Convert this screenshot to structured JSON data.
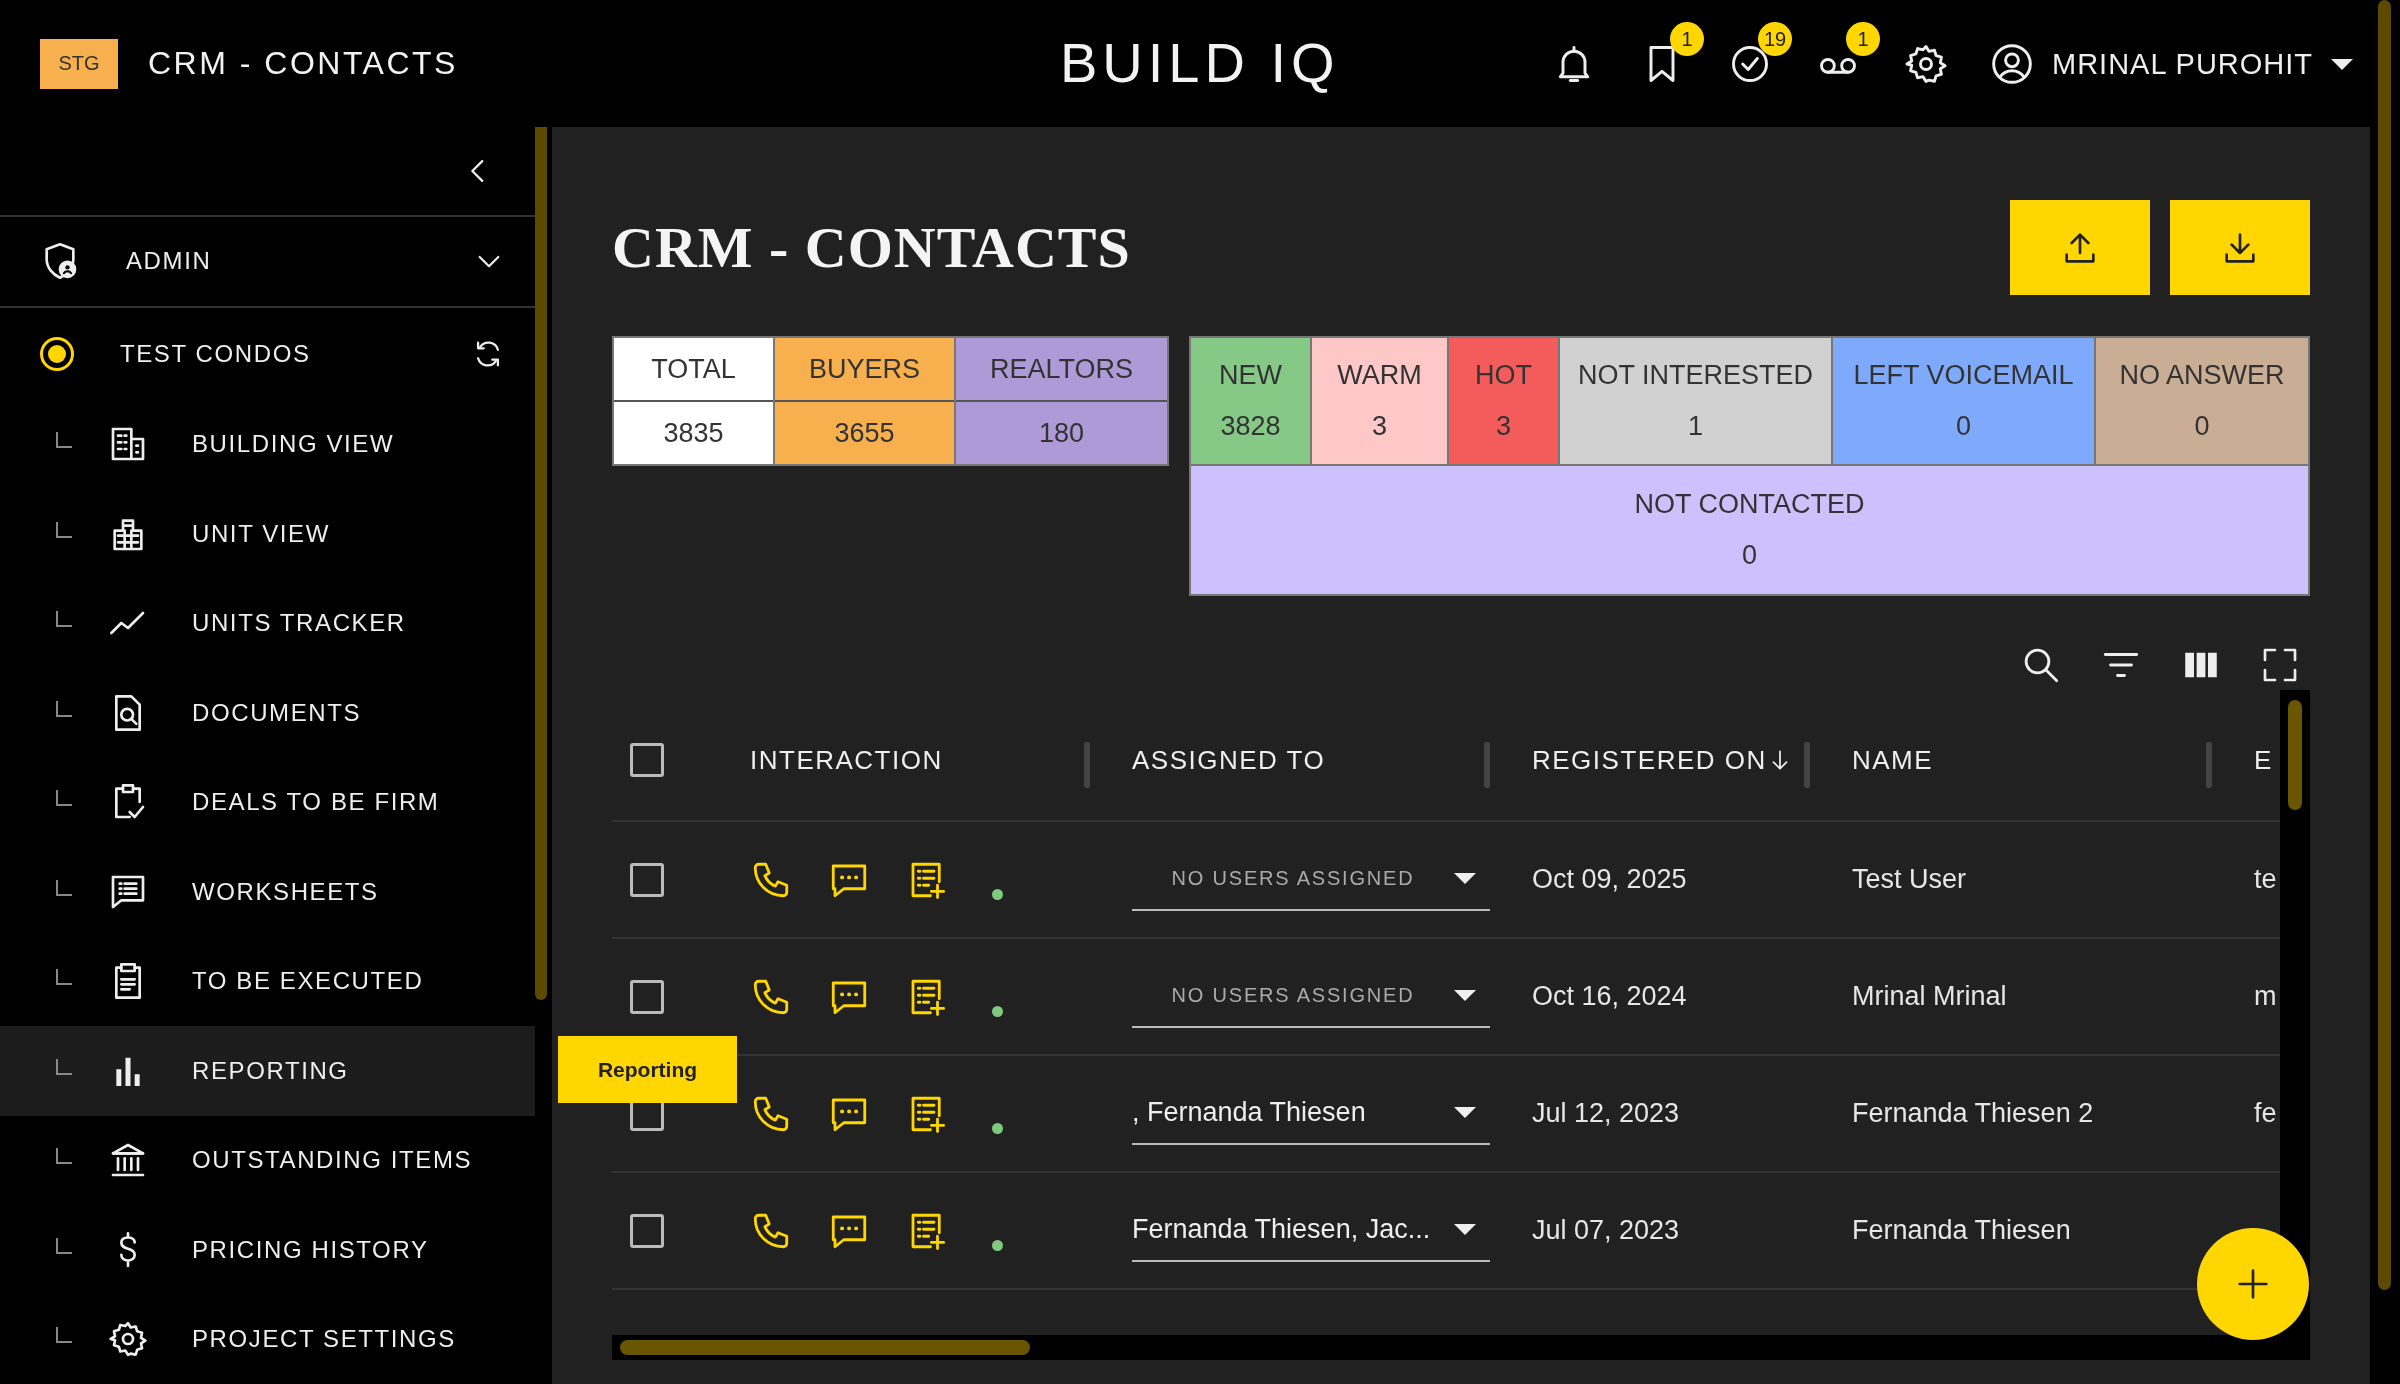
{
  "header": {
    "env_badge": "STG",
    "page_title": "CRM - CONTACTS",
    "brand": "BUILD IQ",
    "alerts": {
      "bookmarks": "1",
      "tasks": "19",
      "voicemail": "1"
    },
    "user_name": "MRINAL PUROHIT"
  },
  "sidebar": {
    "admin": {
      "label": "ADMIN"
    },
    "project": {
      "label": "TEST CONDOS",
      "selected": true
    },
    "items": [
      {
        "label": "BUILDING VIEW",
        "selected": false
      },
      {
        "label": "UNIT VIEW",
        "selected": false
      },
      {
        "label": "UNITS TRACKER",
        "selected": false
      },
      {
        "label": "DOCUMENTS",
        "selected": false
      },
      {
        "label": "DEALS TO BE FIRM",
        "selected": false
      },
      {
        "label": "WORKSHEETS",
        "selected": false
      },
      {
        "label": "TO BE EXECUTED",
        "selected": false
      },
      {
        "label": "REPORTING",
        "selected": true
      },
      {
        "label": "OUTSTANDING ITEMS",
        "selected": false
      },
      {
        "label": "PRICING HISTORY",
        "selected": false
      },
      {
        "label": "PROJECT SETTINGS",
        "selected": false
      }
    ]
  },
  "tooltip": "Reporting",
  "title": "CRM - CONTACTS",
  "summary": [
    {
      "label": "TOTAL",
      "value": "3835",
      "color": "#ffffff"
    },
    {
      "label": "BUYERS",
      "value": "3655",
      "color": "#f8b04f"
    },
    {
      "label": "REALTORS",
      "value": "180",
      "color": "#ae9ad6"
    }
  ],
  "statuses": [
    {
      "label": "NEW",
      "value": "3828",
      "color": "#86c986"
    },
    {
      "label": "WARM",
      "value": "3",
      "color": "#fec8c8"
    },
    {
      "label": "HOT",
      "value": "3",
      "color": "#f45b5b"
    },
    {
      "label": "NOT INTERESTED",
      "value": "1",
      "color": "#d1d1d1"
    },
    {
      "label": "LEFT VOICEMAIL",
      "value": "0",
      "color": "#7faafb"
    },
    {
      "label": "NO ANSWER",
      "value": "0",
      "color": "#c9ae95"
    },
    {
      "label": "NOT CONTACTED",
      "value": "0",
      "color": "#cdc1fd"
    }
  ],
  "table": {
    "select_all": {
      "checked": false
    },
    "columns": [
      {
        "label": "INTERACTION",
        "sorted": false
      },
      {
        "label": "ASSIGNED TO",
        "sorted": false
      },
      {
        "label": "REGISTERED ON",
        "sorted": true
      },
      {
        "label": "NAME",
        "sorted": false
      },
      {
        "label": "E",
        "sorted": false
      }
    ],
    "rows": [
      {
        "checked": false,
        "color": "#7fc97f",
        "assigned": {
          "placeholder": "NO USERS ASSIGNED"
        },
        "registered_on": "Oct 09, 2025",
        "name": "Test User",
        "email": "te"
      },
      {
        "checked": false,
        "color": "#7fc97f",
        "assigned": {
          "placeholder": "NO USERS ASSIGNED"
        },
        "registered_on": "Oct 16, 2024",
        "name": "Mrinal Mrinal",
        "email": "m"
      },
      {
        "checked": false,
        "color": "#7fc97f",
        "assigned": {
          "value": ", Fernanda Thiesen"
        },
        "registered_on": "Jul 12, 2023",
        "name": "Fernanda Thiesen 2",
        "email": "fe"
      },
      {
        "checked": false,
        "color": "#7fc97f",
        "assigned": {
          "value": "Fernanda Thiesen, Jac..."
        },
        "registered_on": "Jul 07, 2023",
        "name": "Fernanda Thiesen"
      }
    ]
  }
}
